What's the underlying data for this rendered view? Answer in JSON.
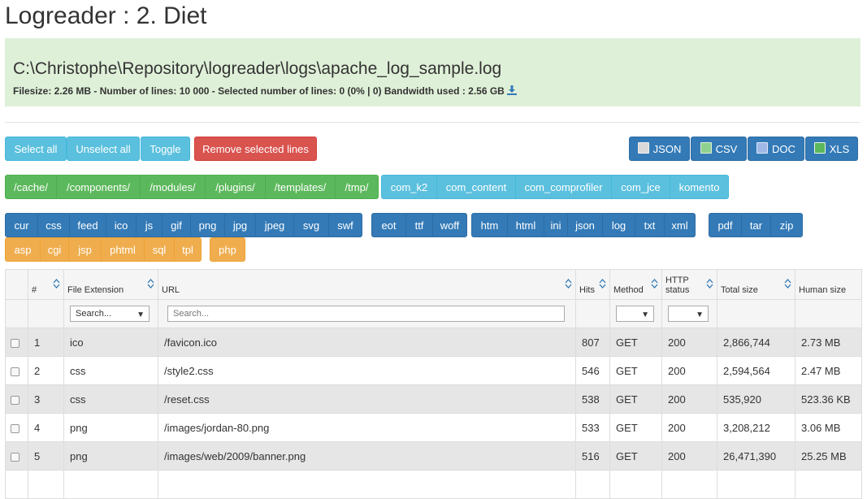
{
  "title": "Logreader : 2. Diet",
  "info": {
    "path": "C:\\Christophe\\Repository\\logreader\\logs\\apache_log_sample.log",
    "stats": "Filesize: 2.26 MB - Number of lines: 10 000 - Selected number of lines: 0 (0% | 0) Bandwidth used : 2.56 GB"
  },
  "toolbar": {
    "select_all": "Select all",
    "unselect_all": "Unselect all",
    "toggle": "Toggle",
    "remove_selected": "Remove selected lines",
    "exports": [
      "JSON",
      "CSV",
      "DOC",
      "XLS"
    ]
  },
  "folder_filters": [
    "/cache/",
    "/components/",
    "/modules/",
    "/plugins/",
    "/templates/",
    "/tmp/"
  ],
  "component_filters": [
    "com_k2",
    "com_content",
    "com_comprofiler",
    "com_jce",
    "komento"
  ],
  "ext_groups": [
    [
      "cur",
      "css",
      "feed",
      "ico",
      "js",
      "gif",
      "png",
      "jpg",
      "jpeg",
      "svg",
      "swf"
    ],
    [
      "eot",
      "ttf",
      "woff"
    ],
    [
      "htm",
      "html",
      "ini",
      "json",
      "log",
      "txt",
      "xml"
    ],
    [
      "pdf",
      "tar",
      "zip"
    ]
  ],
  "script_exts": [
    "asp",
    "cgi",
    "jsp",
    "phtml",
    "sql",
    "tpl"
  ],
  "php_ext": "php",
  "table": {
    "headers": [
      "#",
      "File Extension",
      "URL",
      "Hits",
      "Method",
      "HTTP status",
      "Total size",
      "Human size"
    ],
    "search_placeholder": "Search...",
    "ext_filter_value": "Search...",
    "rows": [
      [
        "1",
        "ico",
        "/favicon.ico",
        "807",
        "GET",
        "200",
        "2,866,744",
        "2.73 MB"
      ],
      [
        "2",
        "css",
        "/style2.css",
        "546",
        "GET",
        "200",
        "2,594,564",
        "2.47 MB"
      ],
      [
        "3",
        "css",
        "/reset.css",
        "538",
        "GET",
        "200",
        "535,920",
        "523.36 KB"
      ],
      [
        "4",
        "png",
        "/images/jordan-80.png",
        "533",
        "GET",
        "200",
        "3,208,212",
        "3.06 MB"
      ],
      [
        "5",
        "png",
        "/images/web/2009/banner.png",
        "516",
        "GET",
        "200",
        "26,471,390",
        "25.25 MB"
      ],
      [
        "",
        "",
        "",
        "",
        "",
        "",
        "",
        ""
      ]
    ]
  }
}
